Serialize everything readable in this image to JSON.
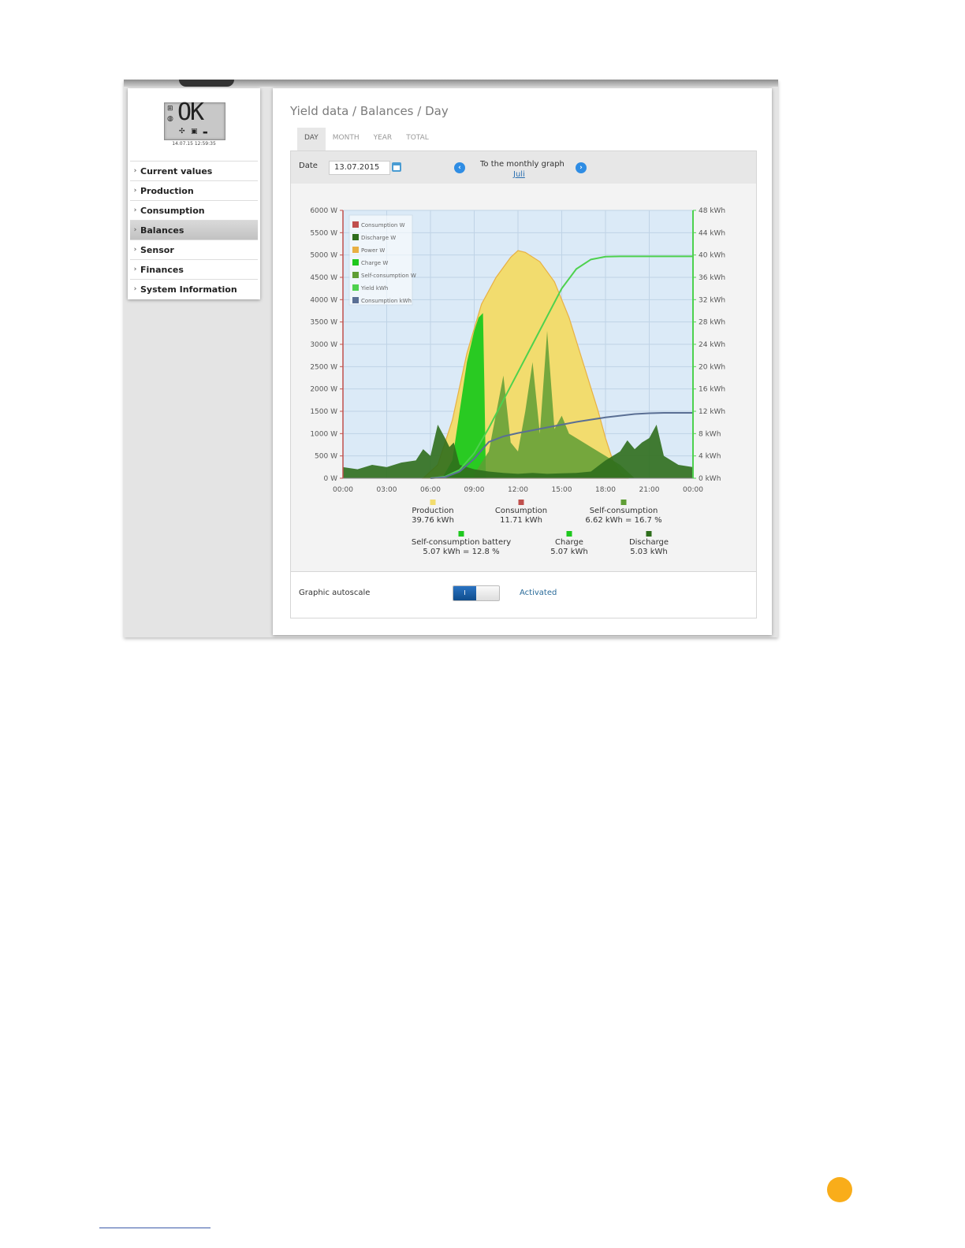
{
  "device": {
    "lcd_text": "OK",
    "timestamp": "14.07.15 12:59:35"
  },
  "sidebar": {
    "items": [
      {
        "label": "Current values",
        "active": false
      },
      {
        "label": "Production",
        "active": false
      },
      {
        "label": "Consumption",
        "active": false
      },
      {
        "label": "Balances",
        "active": true
      },
      {
        "label": "Sensor",
        "active": false
      },
      {
        "label": "Finances",
        "active": false
      },
      {
        "label": "System Information",
        "active": false
      }
    ]
  },
  "main": {
    "breadcrumb": "Yield data / Balances / Day",
    "tabs": [
      "DAY",
      "MONTH",
      "YEAR",
      "TOTAL"
    ],
    "active_tab": "DAY",
    "date_label": "Date",
    "date_value": "13.07.2015",
    "monthly_link_title": "To the monthly graph",
    "monthly_link_text": "Juli",
    "autoscale_label": "Graphic autoscale",
    "autoscale_toggle_text": "I",
    "autoscale_state": "Activated"
  },
  "chart_data": {
    "type": "area",
    "x_ticks": [
      "00:00",
      "03:00",
      "06:00",
      "09:00",
      "12:00",
      "15:00",
      "18:00",
      "21:00",
      "00:00"
    ],
    "y_left_ticks": [
      "0 W",
      "500 W",
      "1000 W",
      "1500 W",
      "2000 W",
      "2500 W",
      "3000 W",
      "3500 W",
      "4000 W",
      "4500 W",
      "5000 W",
      "5500 W",
      "6000 W"
    ],
    "y_right_ticks": [
      "0 kWh",
      "4 kWh",
      "8 kWh",
      "12 kWh",
      "16 kWh",
      "20 kWh",
      "24 kWh",
      "28 kWh",
      "32 kWh",
      "36 kWh",
      "40 kWh",
      "44 kWh",
      "48 kWh"
    ],
    "ylim_left": [
      0,
      6000
    ],
    "ylim_right": [
      0,
      48
    ],
    "grid": true,
    "legend_position": "top-left",
    "legend": [
      "Consumption W",
      "Discharge W",
      "Power W",
      "Charge W",
      "Self-consumption W",
      "Yield kWh",
      "Consumption kWh"
    ],
    "colors": {
      "production": "#f2dc6e",
      "production_line": "#e8b043",
      "consumption": "#c0504d",
      "discharge": "#2f6e1c",
      "charge": "#1ec81e",
      "self_consumption": "#5f9e35",
      "yield_kwh": "#4ed14e",
      "consumption_kwh": "#5a6f94",
      "plot_bg": "#dbeaf7"
    },
    "series": [
      {
        "name": "Power W",
        "x": [
          5.5,
          6.5,
          7.5,
          8.5,
          9.5,
          10.5,
          11.5,
          12.0,
          12.5,
          13.5,
          14.5,
          15.5,
          16.5,
          17.5,
          18.0,
          18.5,
          19.0,
          19.5
        ],
        "values": [
          0,
          300,
          1300,
          2800,
          3900,
          4500,
          4950,
          5100,
          5060,
          4850,
          4400,
          3600,
          2550,
          1500,
          900,
          400,
          120,
          0
        ]
      },
      {
        "name": "Charge W",
        "x": [
          6.8,
          7.5,
          8.0,
          8.5,
          9.0,
          9.3,
          9.6,
          9.7,
          9.8
        ],
        "values": [
          0,
          400,
          1500,
          2600,
          3300,
          3600,
          3700,
          2000,
          0
        ]
      },
      {
        "name": "Yield kWh",
        "x": [
          6,
          7,
          8,
          9,
          10,
          11,
          12,
          13,
          14,
          15,
          16,
          17,
          18,
          19,
          21,
          24
        ],
        "values": [
          0,
          0.3,
          1.5,
          4.5,
          9,
          14,
          19,
          24,
          29,
          34,
          37.5,
          39.2,
          39.7,
          39.76,
          39.76,
          39.76
        ]
      },
      {
        "name": "Consumption kWh",
        "x": [
          6,
          7,
          8,
          9,
          10,
          11,
          12,
          13,
          14,
          15,
          16,
          17,
          18,
          19,
          20,
          21,
          22,
          24
        ],
        "values": [
          0,
          0.2,
          1.2,
          3.5,
          6.5,
          7.5,
          8.1,
          8.6,
          9.1,
          9.6,
          10.1,
          10.5,
          10.9,
          11.2,
          11.5,
          11.65,
          11.71,
          11.71
        ]
      },
      {
        "name": "Discharge W",
        "x": [
          0,
          1,
          2,
          3,
          4,
          5,
          5.5,
          6,
          6.5,
          7,
          7.3,
          7.6,
          8,
          9,
          10,
          11,
          12,
          13,
          14,
          15,
          16,
          17,
          18,
          19,
          19.5,
          20,
          20.5,
          21,
          21.5,
          22,
          23,
          24
        ],
        "values": [
          250,
          200,
          300,
          250,
          350,
          400,
          650,
          500,
          1200,
          900,
          700,
          800,
          300,
          200,
          150,
          120,
          100,
          120,
          100,
          110,
          120,
          150,
          400,
          600,
          850,
          650,
          800,
          900,
          1200,
          500,
          300,
          250
        ]
      },
      {
        "name": "Self-consumption W",
        "x": [
          9,
          10,
          11,
          11.5,
          12,
          12.5,
          13,
          13.5,
          14,
          14.5,
          15,
          15.5,
          16,
          17,
          18,
          19,
          20
        ],
        "values": [
          100,
          600,
          2300,
          800,
          600,
          1500,
          2600,
          1000,
          3300,
          1100,
          1400,
          1000,
          900,
          700,
          500,
          300,
          0
        ]
      }
    ],
    "summary": [
      {
        "label": "Production",
        "value": "39.76 kWh",
        "color": "#f2dc6e"
      },
      {
        "label": "Consumption",
        "value": "11.71 kWh",
        "color": "#c0504d"
      },
      {
        "label": "Self-consumption",
        "value": "6.62 kWh = 16.7 %",
        "color": "#5f9e35"
      },
      {
        "label": "Self-consumption battery",
        "value": "5.07 kWh = 12.8 %",
        "color": "#1ec81e"
      },
      {
        "label": "Charge",
        "value": "5.07 kWh",
        "color": "#1ec81e"
      },
      {
        "label": "Discharge",
        "value": "5.03 kWh",
        "color": "#2f6e1c"
      }
    ]
  }
}
